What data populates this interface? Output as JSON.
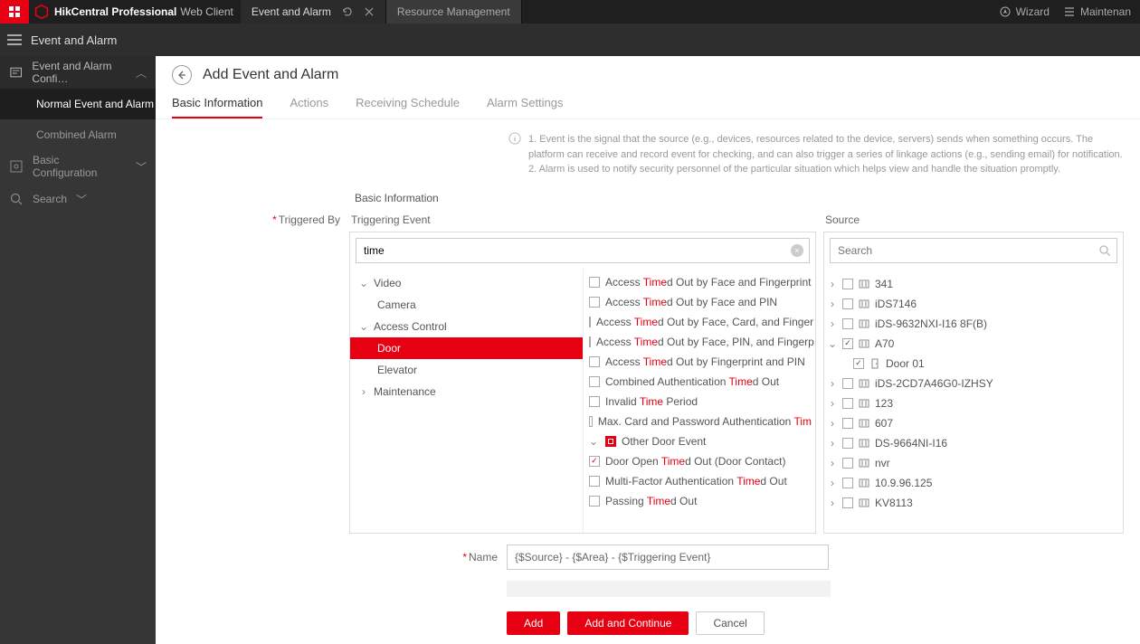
{
  "brand": {
    "name_bold": "HikCentral Professional",
    "name_light": "Web Client"
  },
  "top_tabs": {
    "active": "Event and Alarm",
    "inactive": "Resource Management"
  },
  "top_right": {
    "wizard": "Wizard",
    "maint": "Maintenan"
  },
  "subbar_title": "Event and Alarm",
  "sidebar": {
    "config": "Event and Alarm Confi…",
    "normal": "Normal Event and Alarm",
    "combined": "Combined Alarm",
    "basic": "Basic Configuration",
    "search": "Search"
  },
  "page": {
    "title": "Add Event and Alarm"
  },
  "tabs": {
    "basic": "Basic Information",
    "actions": "Actions",
    "schedule": "Receiving Schedule",
    "alarm": "Alarm Settings"
  },
  "info": {
    "l1": "1. Event is the signal that the source (e.g., devices, resources related to the device, servers) sends when something occurs. The platform can receive and record event for checking, and can also trigger a series of linkage actions (e.g., sending email) for notification.",
    "l2": "2. Alarm is used to notify security personnel of the particular situation which helps view and handle the situation promptly."
  },
  "section": "Basic Information",
  "labels": {
    "triggered": "Triggered By",
    "triggering": "Triggering Event",
    "source": "Source",
    "name": "Name"
  },
  "search_value": "time",
  "source_placeholder": "Search",
  "categories": {
    "video": "Video",
    "camera": "Camera",
    "access": "Access Control",
    "door": "Door",
    "elevator": "Elevator",
    "maint": "Maintenance"
  },
  "events": {
    "e1": {
      "a": "Access ",
      "b": "Time",
      "c": "d Out by Face and Fingerprint"
    },
    "e2": {
      "a": "Access ",
      "b": "Time",
      "c": "d Out by Face and PIN"
    },
    "e3": {
      "a": "Access ",
      "b": "Time",
      "c": "d Out by Face, Card, and Finger"
    },
    "e4": {
      "a": "Access ",
      "b": "Time",
      "c": "d Out by Face, PIN, and Fingerp"
    },
    "e5": {
      "a": "Access ",
      "b": "Time",
      "c": "d Out by Fingerprint and PIN"
    },
    "e6": {
      "a": "Combined Authentication ",
      "b": "Time",
      "c": "d Out"
    },
    "e7": {
      "a": "Invalid ",
      "b": "Time",
      "c": " Period"
    },
    "e8": {
      "a": "Max. Card and Password Authentication ",
      "b": "Tim",
      "c": ""
    },
    "sec": "Other Door Event",
    "e9": {
      "a": "Door Open ",
      "b": "Time",
      "c": "d Out (Door Contact)"
    },
    "e10": {
      "a": "Multi-Factor Authentication ",
      "b": "Time",
      "c": "d Out"
    },
    "e11": {
      "a": "Passing ",
      "b": "Time",
      "c": "d Out"
    }
  },
  "sources": {
    "s1": "341",
    "s2": "iDS7146",
    "s3": "iDS-9632NXI-I16 8F(B)",
    "s4": "A70",
    "s4c": "Door 01",
    "s5": "iDS-2CD7A46G0-IZHSY",
    "s6": "123",
    "s7": "607",
    "s8": "DS-9664NI-I16",
    "s9": "nvr",
    "s10": "10.9.96.125",
    "s11": "KV8113"
  },
  "name_value": "{$Source} - {$Area} - {$Triggering Event}",
  "buttons": {
    "add": "Add",
    "addc": "Add and Continue",
    "cancel": "Cancel"
  }
}
